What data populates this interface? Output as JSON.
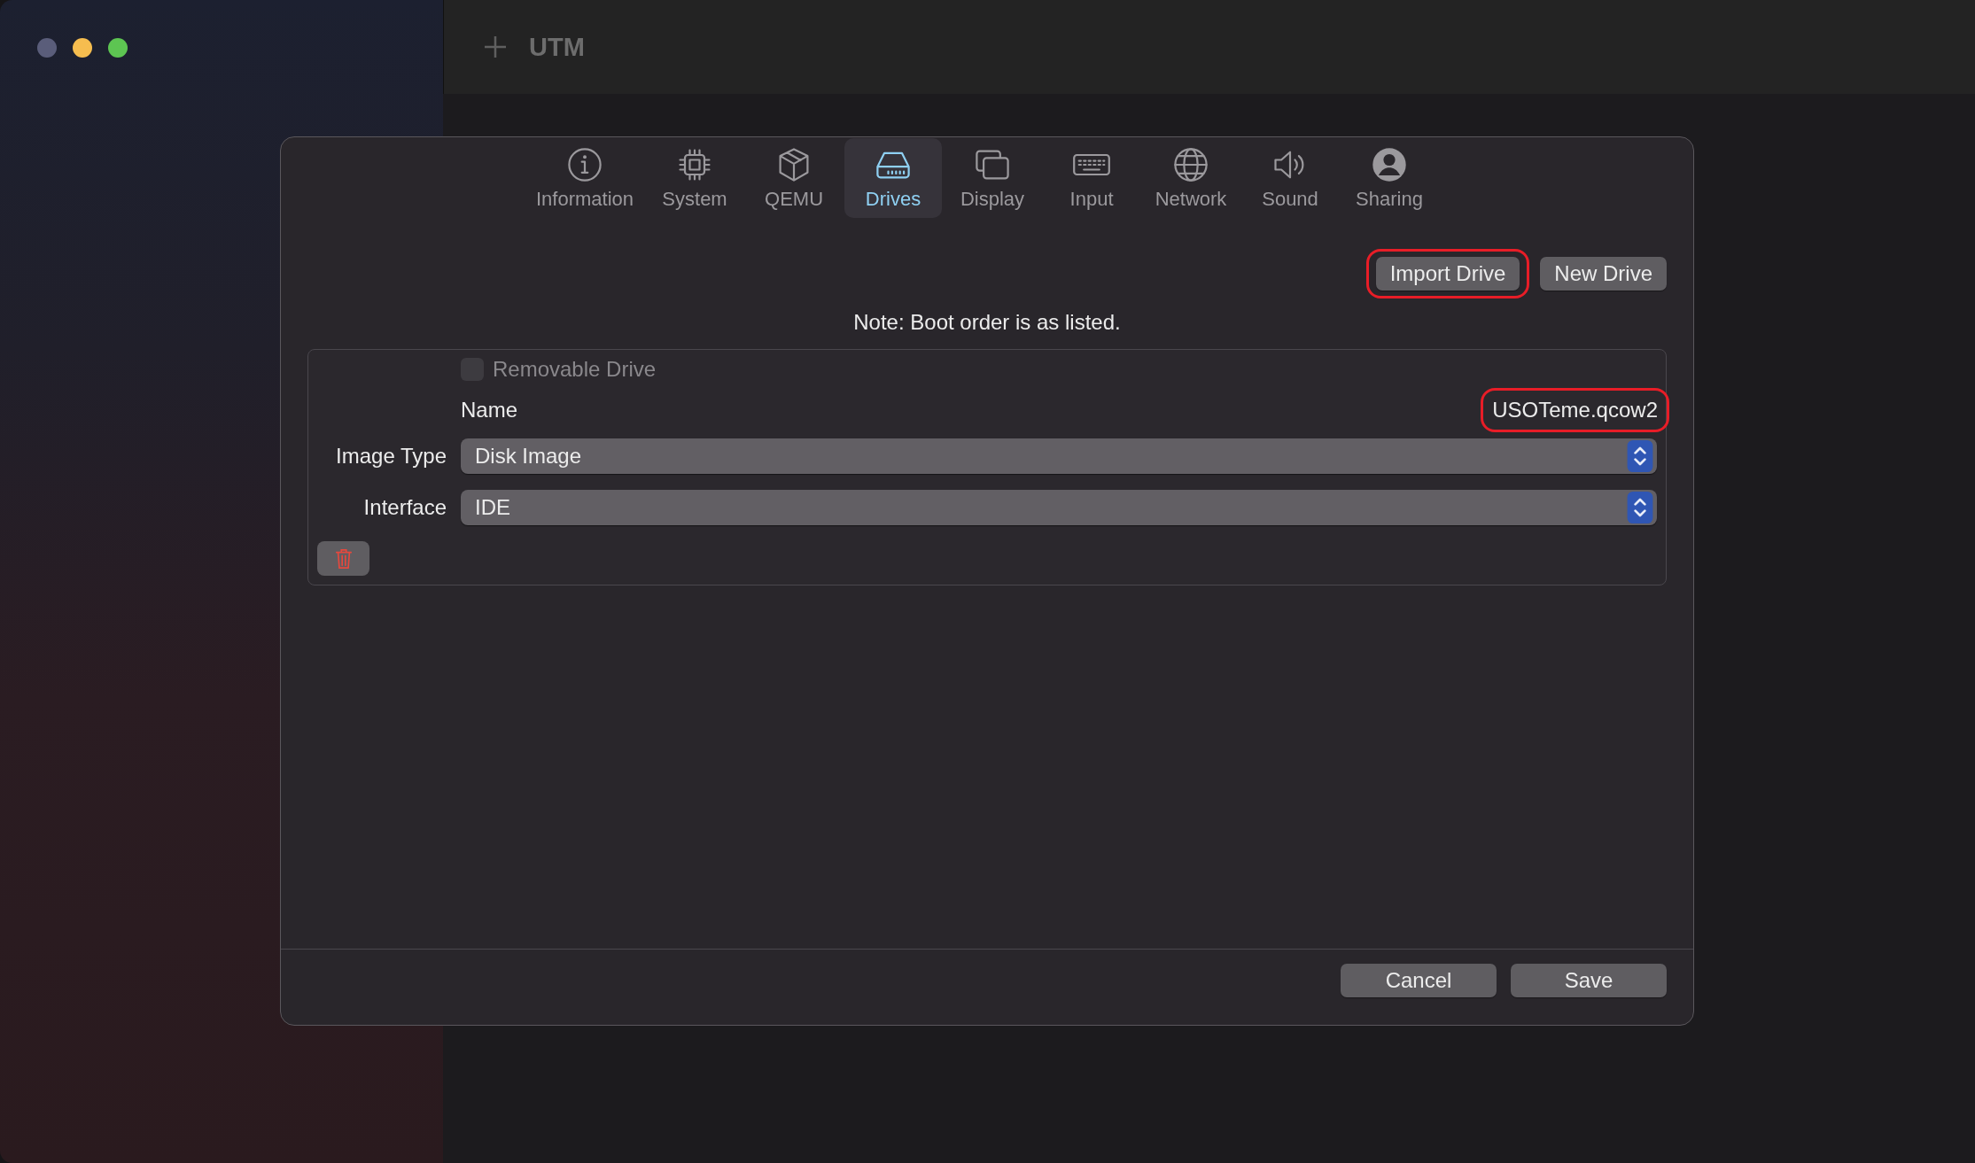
{
  "toolbar": {
    "title": "UTM"
  },
  "dialog": {
    "tabs": [
      {
        "label": "Information",
        "selected": false
      },
      {
        "label": "System",
        "selected": false
      },
      {
        "label": "QEMU",
        "selected": false
      },
      {
        "label": "Drives",
        "selected": true
      },
      {
        "label": "Display",
        "selected": false
      },
      {
        "label": "Input",
        "selected": false
      },
      {
        "label": "Network",
        "selected": false
      },
      {
        "label": "Sound",
        "selected": false
      },
      {
        "label": "Sharing",
        "selected": false
      }
    ],
    "drive_buttons": [
      {
        "label": "Import Drive",
        "highlighted": true
      },
      {
        "label": "New Drive",
        "highlighted": false
      }
    ],
    "note": "Note: Boot order is as listed.",
    "drive": {
      "removable": {
        "label": "Removable Drive",
        "checked": false,
        "disabled": true
      },
      "name": {
        "label": "Name",
        "value": "USOTeme.qcow2",
        "highlighted": true
      },
      "image_type": {
        "label": "Image Type",
        "value": "Disk Image"
      },
      "interface": {
        "label": "Interface",
        "value": "IDE"
      }
    },
    "footer_buttons": [
      {
        "label": "Cancel"
      },
      {
        "label": "Save"
      }
    ]
  }
}
